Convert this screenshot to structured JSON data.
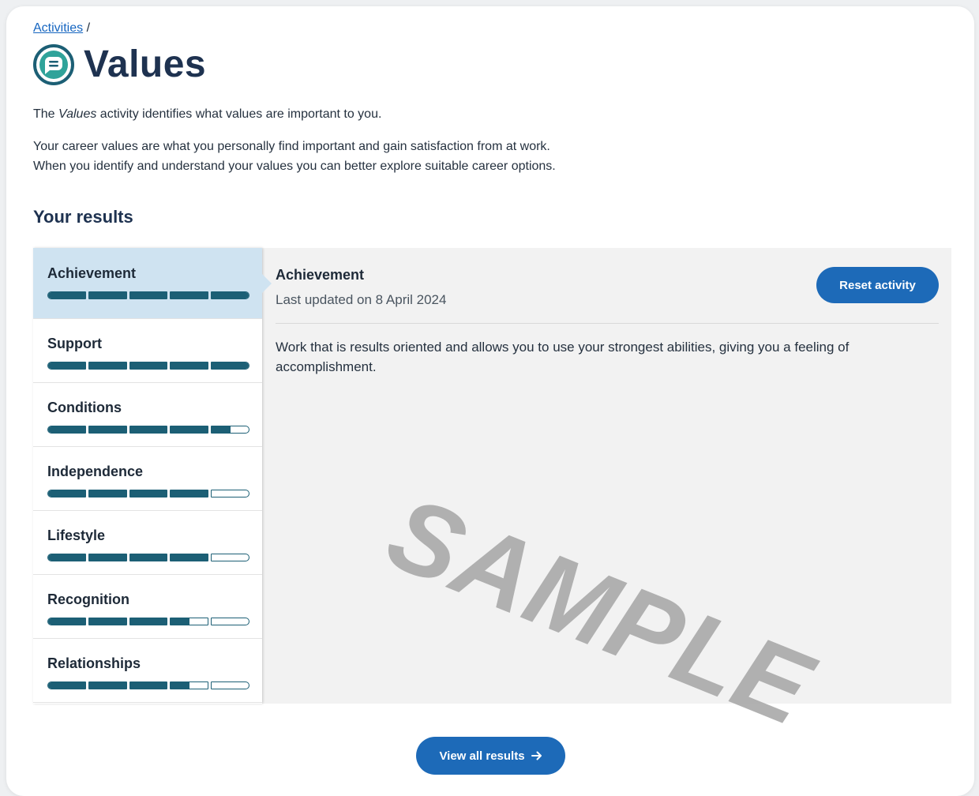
{
  "breadcrumb": {
    "link": "Activities",
    "separator": "/"
  },
  "page": {
    "title": "Values",
    "icon": "speech-bubble-icon",
    "intro_prefix": "The ",
    "intro_em": "Values",
    "intro_suffix": " activity identifies what values are important to you.",
    "intro2_line1": "Your career values are what you personally find important and gain satisfaction from at work.",
    "intro2_line2": "When you identify and understand your values you can better explore suitable career options."
  },
  "results": {
    "heading": "Your results",
    "values": [
      {
        "name": "Achievement",
        "score": 5.0,
        "selected": true
      },
      {
        "name": "Support",
        "score": 5.0,
        "selected": false
      },
      {
        "name": "Conditions",
        "score": 4.5,
        "selected": false
      },
      {
        "name": "Independence",
        "score": 4.0,
        "selected": false
      },
      {
        "name": "Lifestyle",
        "score": 4.0,
        "selected": false
      },
      {
        "name": "Recognition",
        "score": 3.5,
        "selected": false
      },
      {
        "name": "Relationships",
        "score": 3.5,
        "selected": false
      }
    ],
    "max_score": 5
  },
  "detail": {
    "title": "Achievement",
    "updated": "Last updated on 8 April 2024",
    "reset_label": "Reset activity",
    "description": "Work that is results oriented and allows you to use your strongest abilities, giving you a feeling of accomplishment."
  },
  "watermark": "SAMPLE",
  "footer": {
    "view_all_label": "View all results",
    "arrow_icon": "arrow-right-icon"
  },
  "colors": {
    "accent": "#1d6ab8",
    "bar": "#1c5f75",
    "selected_bg": "#cfe3f1",
    "title": "#1e3250"
  }
}
